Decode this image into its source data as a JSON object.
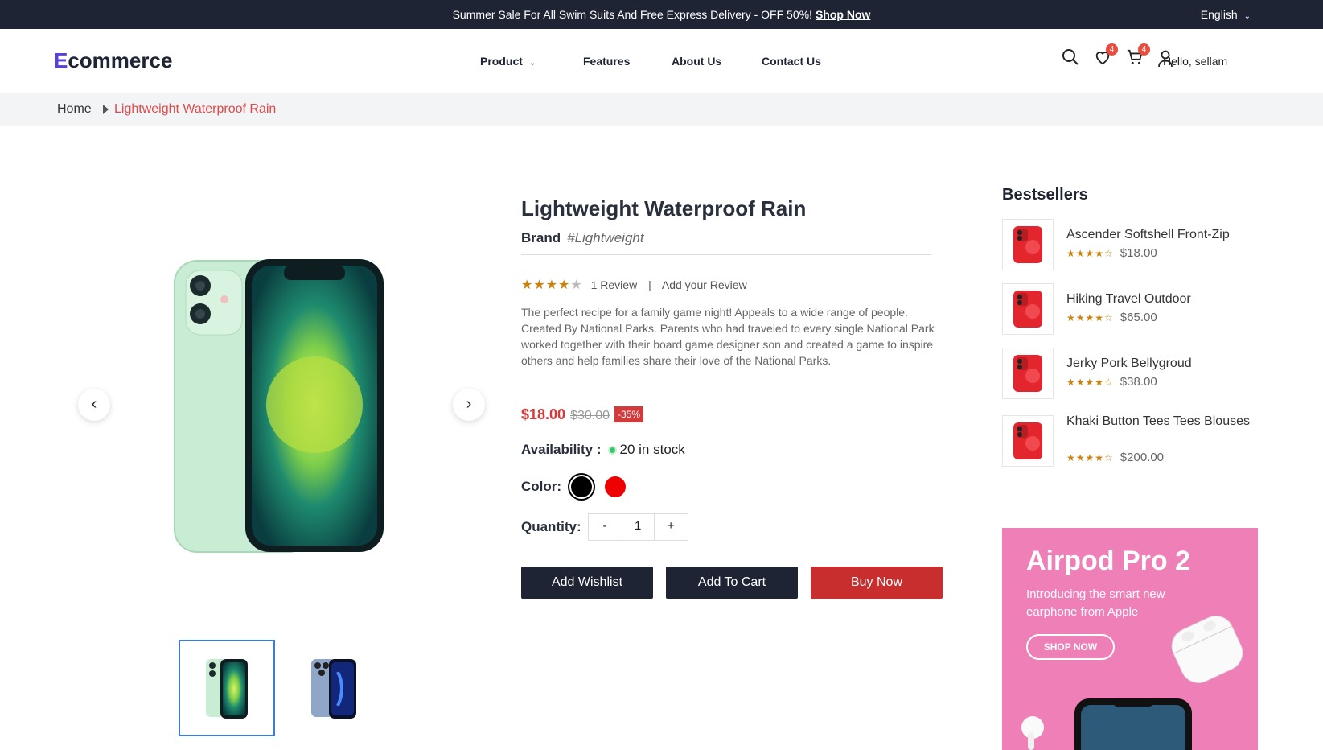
{
  "topbar": {
    "message": "Summer Sale For All Swim Suits And Free Express Delivery - OFF 50%!",
    "cta": "Shop Now",
    "language": "English"
  },
  "header": {
    "logo_first": "E",
    "logo_rest": "commerce",
    "nav": [
      "Product",
      "Features",
      "About Us",
      "Contact Us"
    ],
    "wishlist_count": "4",
    "cart_count": "4",
    "greeting": "Hello, sellam"
  },
  "breadcrumb": {
    "home": "Home",
    "current": "Lightweight Waterproof Rain"
  },
  "product": {
    "title": "Lightweight Waterproof Rain",
    "brand_label": "Brand",
    "brand_value": "#Lightweight",
    "rating": 4,
    "reviews": "1 Review",
    "add_review": "Add your Review",
    "description": "The perfect recipe for a family game night! Appeals to a wide range of people. Created By National Parks. Parents who had traveled to every single National Park worked together with their board game designer son and created a game to inspire others and help families share their love of the National Parks.",
    "price": "$18.00",
    "old_price": "$30.00",
    "discount": "-35%",
    "availability_label": "Availability :",
    "availability_value": "20 in stock",
    "color_label": "Color:",
    "colors": [
      "#000000",
      "#ee0000"
    ],
    "quantity_label": "Quantity:",
    "quantity": "1",
    "minus": "-",
    "plus": "+",
    "buttons": {
      "wishlist": "Add Wishlist",
      "cart": "Add To Cart",
      "buy": "Buy Now"
    }
  },
  "bestsellers": {
    "title": "Bestsellers",
    "items": [
      {
        "name": "Ascender Softshell Front-Zip",
        "price": "$18.00"
      },
      {
        "name": "Hiking Travel Outdoor",
        "price": "$65.00"
      },
      {
        "name": "Jerky Pork Bellygroud",
        "price": "$38.00"
      },
      {
        "name": "Khaki Button Tees Tees Blouses",
        "price": "$200.00"
      }
    ]
  },
  "banner": {
    "title": "Airpod Pro 2",
    "subtitle": "Introducing the smart new earphone from Apple",
    "cta": "SHOP NOW"
  }
}
